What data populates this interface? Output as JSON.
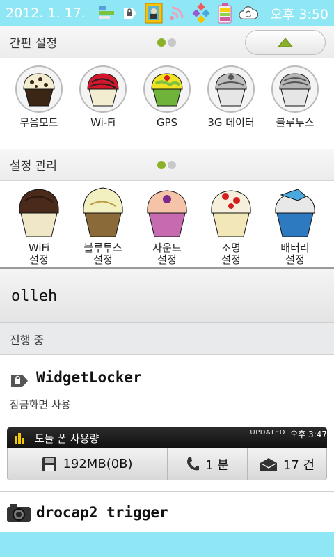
{
  "status_bar": {
    "date": "2012. 1. 17.",
    "time": "오후 3:50",
    "icons": [
      "stack-icon",
      "lock-tag-icon",
      "photo-frame-icon",
      "wifi-icon",
      "diamond-shapes-icon",
      "battery-icon",
      "sync-icon"
    ],
    "color": "#8fe6f4"
  },
  "quick_settings": {
    "title": "간편 설정",
    "items": [
      {
        "label": "무음모드"
      },
      {
        "label": "Wi-Fi"
      },
      {
        "label": "GPS"
      },
      {
        "label": "3G 데이터"
      },
      {
        "label": "블루투스"
      }
    ]
  },
  "settings_management": {
    "title": "설정 관리",
    "items": [
      {
        "label": "WiFi\n설정",
        "line1": "WiFi",
        "line2": "설정"
      },
      {
        "label": "블루투스\n설정",
        "line1": "블루투스",
        "line2": "설정"
      },
      {
        "label": "사운드\n설정",
        "line1": "사운드",
        "line2": "설정"
      },
      {
        "label": "조명\n설정",
        "line1": "조명",
        "line2": "설정"
      },
      {
        "label": "배터리\n설정",
        "line1": "배터리",
        "line2": "설정"
      }
    ]
  },
  "carrier": {
    "label": "olleh"
  },
  "ongoing": {
    "label": "진행 중"
  },
  "widgetlocker": {
    "title": "WidgetLocker",
    "subtitle": "잠금화면 사용"
  },
  "dodol": {
    "title": "도돌 폰 사용량",
    "updated": "UPDATED",
    "time": "오후 3:47",
    "data_usage": "192MB(0B)",
    "call_usage": "1 분",
    "message_usage": "17 건",
    "accent": "#f5c800"
  },
  "drocap": {
    "title": "drocap2 trigger"
  }
}
